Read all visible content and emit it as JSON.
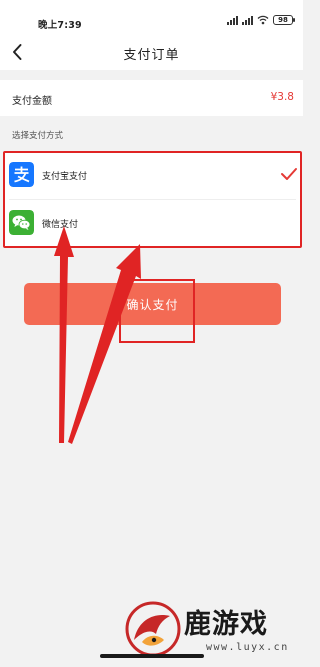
{
  "status_bar": {
    "time": "晚上7:39",
    "battery": "98"
  },
  "nav": {
    "title": "支付订单",
    "back_icon": "chevron-left-icon"
  },
  "amount": {
    "label": "支付金额",
    "value": "¥3.8"
  },
  "payment": {
    "section_label": "选择支付方式",
    "methods": [
      {
        "name": "支付宝支付",
        "icon": "alipay-icon",
        "color": "#1677ff",
        "selected": true
      },
      {
        "name": "微信支付",
        "icon": "wechat-icon",
        "color": "#3cb034",
        "selected": false
      }
    ]
  },
  "confirm_button": {
    "label": "确认支付",
    "color": "#f36a54"
  },
  "annotation_color": "#e02424",
  "watermark": {
    "text": "鹿游戏",
    "url": "www.luyx.cn"
  }
}
